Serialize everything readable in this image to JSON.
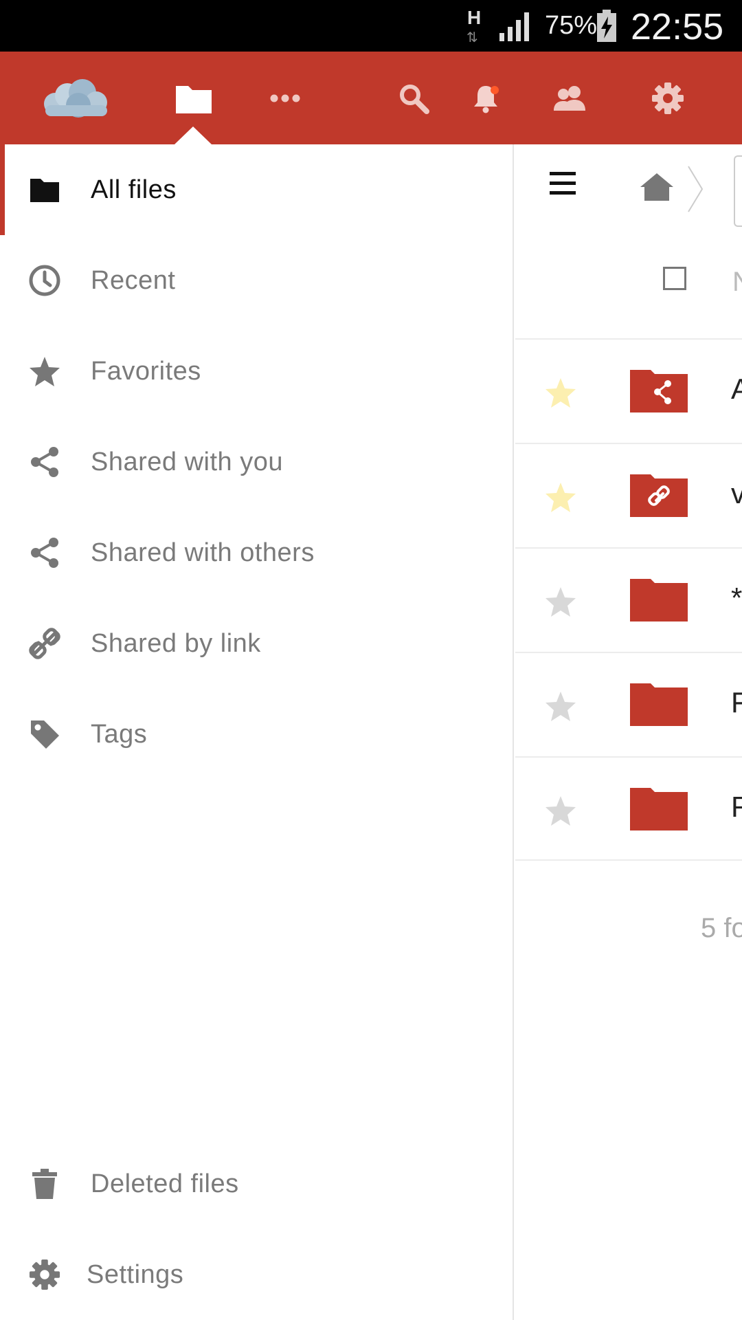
{
  "status_bar": {
    "network_type": "H",
    "network_arrows": "⇅",
    "battery_percent": "75%",
    "time": "22:55"
  },
  "header": {
    "accent_color": "#c0392b",
    "icons": [
      "cloud-logo-icon",
      "folder-icon",
      "more-icon",
      "search-icon",
      "bell-icon",
      "contacts-icon",
      "gear-icon"
    ]
  },
  "sidebar": {
    "items": [
      {
        "label": "All files",
        "icon": "folder-icon",
        "active": true
      },
      {
        "label": "Recent",
        "icon": "clock-icon"
      },
      {
        "label": "Favorites",
        "icon": "star-icon"
      },
      {
        "label": "Shared with you",
        "icon": "share-icon"
      },
      {
        "label": "Shared with others",
        "icon": "share-icon"
      },
      {
        "label": "Shared by link",
        "icon": "link-icon"
      },
      {
        "label": "Tags",
        "icon": "tag-icon"
      }
    ],
    "footer": [
      {
        "label": "Deleted files",
        "icon": "trash-icon"
      },
      {
        "label": "Settings",
        "icon": "gear-icon"
      }
    ]
  },
  "content": {
    "header_initial": "N",
    "rows": [
      {
        "name": "A",
        "favorite": true,
        "folder_type": "shared"
      },
      {
        "name": "v",
        "favorite": true,
        "folder_type": "link"
      },
      {
        "name": "*",
        "favorite": false,
        "folder_type": "plain"
      },
      {
        "name": "F",
        "favorite": false,
        "folder_type": "plain"
      },
      {
        "name": "R",
        "favorite": false,
        "folder_type": "plain"
      }
    ],
    "summary": "5 fo"
  }
}
